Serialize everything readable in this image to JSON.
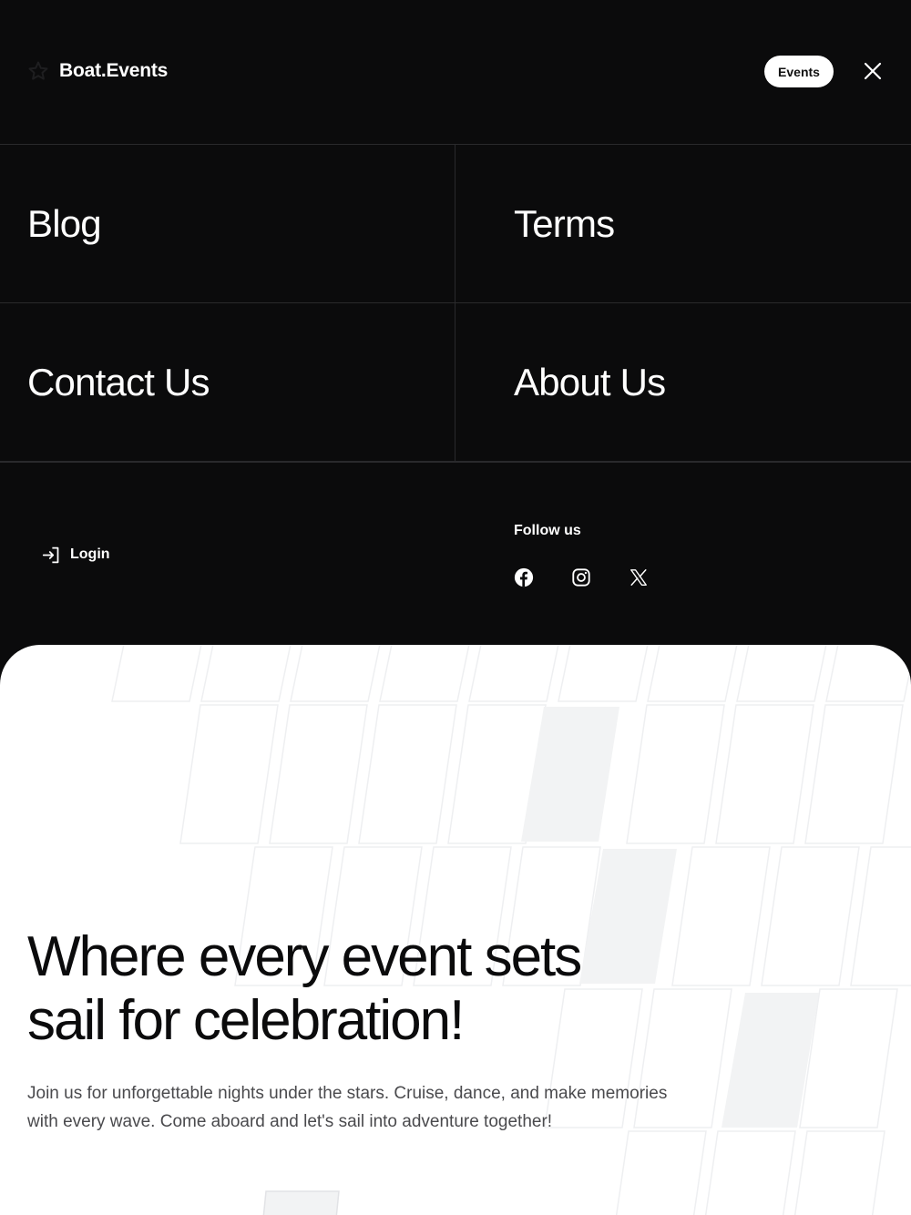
{
  "header": {
    "brand_name": "Boat.Events",
    "brand_icon": "star-icon",
    "events_button": "Events",
    "close_icon": "close-icon"
  },
  "menu": {
    "items": [
      {
        "label": "Blog"
      },
      {
        "label": "Terms"
      },
      {
        "label": "Contact Us"
      },
      {
        "label": "About Us"
      }
    ]
  },
  "footer": {
    "login_label": "Login",
    "login_icon": "login-icon",
    "follow_title": "Follow us",
    "social": [
      {
        "name": "facebook-icon"
      },
      {
        "name": "instagram-icon"
      },
      {
        "name": "x-icon"
      }
    ]
  },
  "hero": {
    "title_line1": "Where every event sets",
    "title_line2": "sail for celebration!",
    "subtitle_line1": "Join us for unforgettable nights under the stars. Cruise, dance, and make memories",
    "subtitle_line2": "with every wave. Come aboard and let's sail into adventure together!"
  },
  "colors": {
    "background": "#0b0b0c",
    "hero_background": "#ffffff",
    "accent_text": "#ffffff",
    "divider": "#2a2a2c",
    "ticket_fill": "#f2f3f4"
  }
}
